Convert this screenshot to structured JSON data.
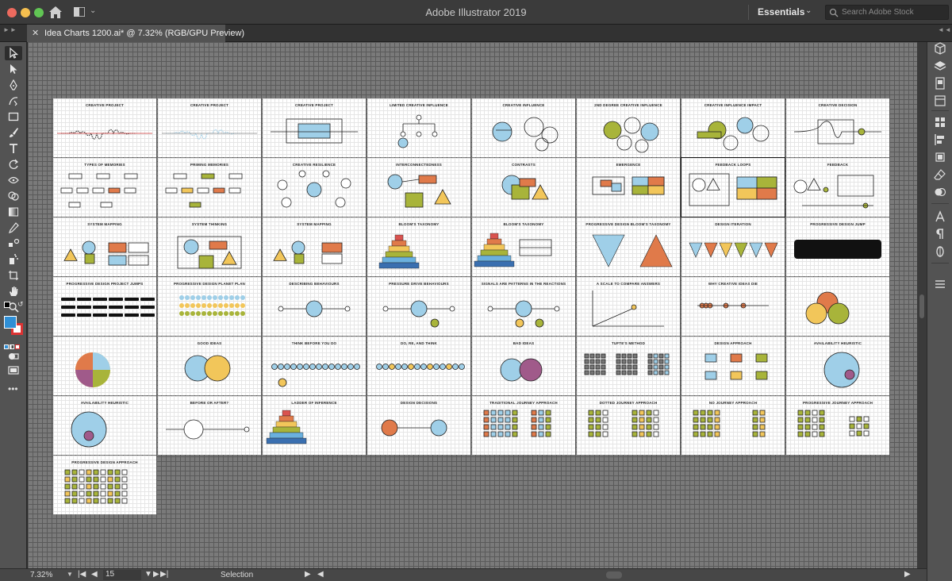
{
  "window": {
    "title": "Adobe Illustrator 2019"
  },
  "workspace": {
    "label": "Essentials"
  },
  "search": {
    "placeholder": "Search Adobe Stock"
  },
  "document_tab": {
    "label": "Idea Charts 1200.ai* @ 7.32% (RGB/GPU Preview)"
  },
  "status": {
    "zoom": "7.32%",
    "artboard": "15",
    "tool": "Selection"
  },
  "colors": {
    "fill": "#2f8fd6",
    "board_blue": "#9fcfe8",
    "board_orange": "#e07a4a",
    "board_green": "#a8b43a",
    "board_yellow": "#f2c65a",
    "board_purple": "#a05a8a"
  },
  "tools": [
    "selection-icon",
    "direct-selection-icon",
    "pen-icon",
    "curvature-icon",
    "rectangle-icon",
    "paintbrush-icon",
    "type-icon",
    "rotate-icon",
    "width-icon",
    "shape-builder-icon",
    "gradient-icon",
    "eyedropper-icon",
    "blend-icon",
    "symbol-sprayer-icon",
    "artboard-icon",
    "hand-icon",
    "zoom-icon"
  ],
  "artboards": [
    {
      "title": "CREATIVE PROJECT"
    },
    {
      "title": "CREATIVE PROJECT"
    },
    {
      "title": "CREATIVE PROJECT"
    },
    {
      "title": "LIMITED CREATIVE INFLUENCE"
    },
    {
      "title": "CREATIVE INFLUENCE"
    },
    {
      "title": "2ND DEGREE CREATIVE INFLUENCE"
    },
    {
      "title": "CREATIVE INFLUENCE IMPACT"
    },
    {
      "title": "CREATIVE DECISION"
    },
    {
      "title": "TYPES OF MEMORIES"
    },
    {
      "title": "PRIMING MEMORIES"
    },
    {
      "title": "CREATIVE RESILIENCE"
    },
    {
      "title": "INTERCONNECTEDNESS"
    },
    {
      "title": "CONTRASTS"
    },
    {
      "title": "EMERGENCE"
    },
    {
      "title": "FEEDBACK LOOPS"
    },
    {
      "title": "FEEDBACK"
    },
    {
      "title": "SYSTEM MAPPING"
    },
    {
      "title": "SYSTEM THINKING"
    },
    {
      "title": "SYSTEM MAPPING"
    },
    {
      "title": "BLOOM'S TAXONOMY"
    },
    {
      "title": "BLOOM'S TAXONOMY"
    },
    {
      "title": "PROGRESSIVE DESIGN        BLOOM'S TAXONOMY"
    },
    {
      "title": "DESIGN ITERATION"
    },
    {
      "title": "PROGRESSIVE DESIGN JUMP"
    },
    {
      "title": "PROGRESSIVE DESIGN PROJECT JUMPS"
    },
    {
      "title": "PROGRESSIVE DESIGN PLANET PLAN"
    },
    {
      "title": "DESCRIBING BEHAVIOURS"
    },
    {
      "title": "PRESSURE DRIVE BEHAVIOURS"
    },
    {
      "title": "SIGNALS ARE PATTERNS IN THE REACTIONS"
    },
    {
      "title": "A SCALE TO COMPARE ANSWERS"
    },
    {
      "title": "WHY CREATIVE IDEAS DIE"
    },
    {
      "title": ""
    },
    {
      "title": ""
    },
    {
      "title": "GOOD IDEAS"
    },
    {
      "title": "THINK BEFORE YOU DO"
    },
    {
      "title": "DO, RE, AND THINK"
    },
    {
      "title": "BAD IDEAS"
    },
    {
      "title": "TUFTE'S METHOD"
    },
    {
      "title": "DESIGN APPROACH"
    },
    {
      "title": "AVAILABILITY HEURISTIC"
    },
    {
      "title": "AVAILABILITY HEURISTIC"
    },
    {
      "title": "BEFORE OR AFTER?"
    },
    {
      "title": "LADDER OF INFERENCE"
    },
    {
      "title": "DESIGN DECISIONS"
    },
    {
      "title": "TRADITIONAL JOURNEY APPROACH"
    },
    {
      "title": "DOTTED JOURNEY APPROACH"
    },
    {
      "title": "NO JOURNEY APPROACH"
    },
    {
      "title": "PROGRESSIVE JOURNEY APPROACH"
    },
    {
      "title": "PROGRESSIVE DESIGN APPROACH"
    }
  ]
}
